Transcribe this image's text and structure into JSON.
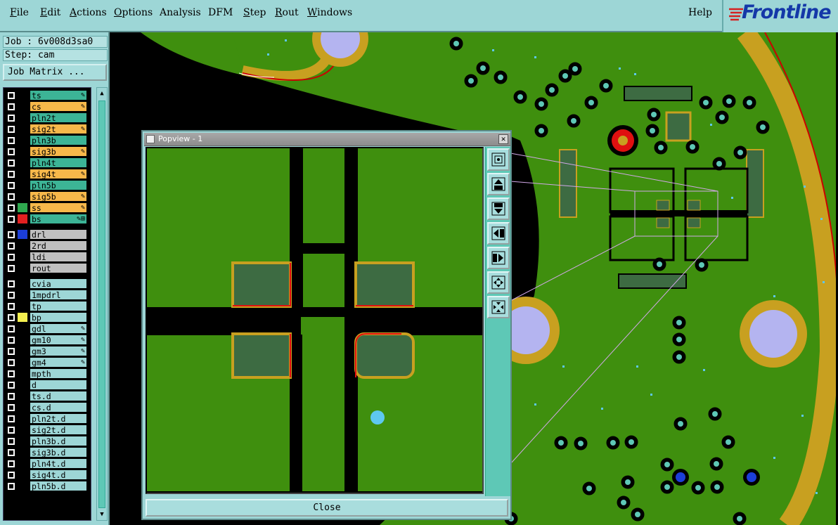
{
  "menubar": {
    "items": [
      "File",
      "Edit",
      "Actions",
      "Options",
      "Analysis",
      "DFM",
      "Step",
      "Rout",
      "Windows"
    ],
    "help": "Help",
    "logo": "Frontline"
  },
  "left_panel": {
    "job": "Job : 6v008d3sa0",
    "step": "Step: cam",
    "job_matrix": "Job Matrix ...",
    "layers": [
      {
        "name": "ts",
        "color": "#000000",
        "bg": "#3cb496",
        "mark": "✎"
      },
      {
        "name": "cs",
        "color": "#000000",
        "bg": "#f7b84a",
        "mark": "✎"
      },
      {
        "name": "pln2t",
        "color": "#000000",
        "bg": "#3cb496",
        "mark": ""
      },
      {
        "name": "sig2t",
        "color": "#000000",
        "bg": "#f7b84a",
        "mark": "✎"
      },
      {
        "name": "pln3b",
        "color": "#000000",
        "bg": "#3cb496",
        "mark": ""
      },
      {
        "name": "sig3b",
        "color": "#000000",
        "bg": "#f7b84a",
        "mark": "✎"
      },
      {
        "name": "pln4t",
        "color": "#000000",
        "bg": "#3cb496",
        "mark": ""
      },
      {
        "name": "sig4t",
        "color": "#000000",
        "bg": "#f7b84a",
        "mark": "✎"
      },
      {
        "name": "pln5b",
        "color": "#000000",
        "bg": "#3cb496",
        "mark": ""
      },
      {
        "name": "sig5b",
        "color": "#000000",
        "bg": "#f7b84a",
        "mark": "✎"
      },
      {
        "name": "ss",
        "color": "#2fa84f",
        "bg": "#f7b84a",
        "mark": "✎"
      },
      {
        "name": "bs",
        "color": "#e32020",
        "bg": "#3cb496",
        "mark": "✎⊞"
      },
      {
        "name": "drl",
        "color": "#1c3ed8",
        "bg": "#c0c0c0",
        "mark": ""
      },
      {
        "name": "2rd",
        "color": "#000000",
        "bg": "#c0c0c0",
        "mark": ""
      },
      {
        "name": "ldi",
        "color": "#000000",
        "bg": "#c0c0c0",
        "mark": ""
      },
      {
        "name": "rout",
        "color": "#000000",
        "bg": "#c0c0c0",
        "mark": ""
      },
      {
        "name": "cvia",
        "color": "#000000",
        "bg": "#9dd6d6",
        "mark": ""
      },
      {
        "name": "1mpdrl",
        "color": "#000000",
        "bg": "#9dd6d6",
        "mark": ""
      },
      {
        "name": "tp",
        "color": "#000000",
        "bg": "#9dd6d6",
        "mark": ""
      },
      {
        "name": "bp",
        "color": "#f4f050",
        "bg": "#9dd6d6",
        "mark": ""
      },
      {
        "name": "gdl",
        "color": "#000000",
        "bg": "#9dd6d6",
        "mark": "✎"
      },
      {
        "name": "gm10",
        "color": "#000000",
        "bg": "#9dd6d6",
        "mark": "✎"
      },
      {
        "name": "gm3",
        "color": "#000000",
        "bg": "#9dd6d6",
        "mark": "✎"
      },
      {
        "name": "gm4",
        "color": "#000000",
        "bg": "#9dd6d6",
        "mark": "✎"
      },
      {
        "name": "mpth",
        "color": "#000000",
        "bg": "#9dd6d6",
        "mark": ""
      },
      {
        "name": "d",
        "color": "#000000",
        "bg": "#9dd6d6",
        "mark": ""
      },
      {
        "name": "ts.d",
        "color": "#000000",
        "bg": "#9dd6d6",
        "mark": ""
      },
      {
        "name": "cs.d",
        "color": "#000000",
        "bg": "#9dd6d6",
        "mark": ""
      },
      {
        "name": "pln2t.d",
        "color": "#000000",
        "bg": "#9dd6d6",
        "mark": ""
      },
      {
        "name": "sig2t.d",
        "color": "#000000",
        "bg": "#9dd6d6",
        "mark": ""
      },
      {
        "name": "pln3b.d",
        "color": "#000000",
        "bg": "#9dd6d6",
        "mark": ""
      },
      {
        "name": "sig3b.d",
        "color": "#000000",
        "bg": "#9dd6d6",
        "mark": ""
      },
      {
        "name": "pln4t.d",
        "color": "#000000",
        "bg": "#9dd6d6",
        "mark": ""
      },
      {
        "name": "sig4t.d",
        "color": "#000000",
        "bg": "#9dd6d6",
        "mark": ""
      },
      {
        "name": "pln5b.d",
        "color": "#000000",
        "bg": "#9dd6d6",
        "mark": ""
      }
    ]
  },
  "popview": {
    "title": "Popview - 1",
    "close_icon": "✕",
    "close_label": "Close",
    "tools": [
      "zoom-fit-icon",
      "pan-up-icon",
      "pan-down-icon",
      "pan-left-icon",
      "pan-right-icon",
      "zoom-out-icon",
      "zoom-in-icon"
    ]
  },
  "colors": {
    "ui": "#9dd6d6",
    "board": "#3f8f0e",
    "gold": "#c8a020",
    "pad": "#3d6b42",
    "via": "#5ec8b6"
  }
}
